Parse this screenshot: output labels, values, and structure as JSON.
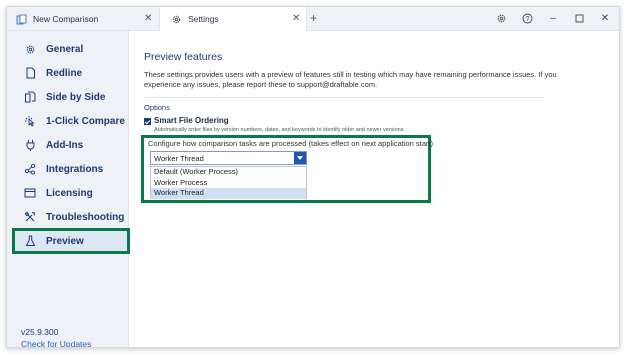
{
  "tabs": {
    "inactive": {
      "label": "New Comparison",
      "icon": "document-compare-icon"
    },
    "active": {
      "label": "Settings",
      "icon": "gear-icon"
    }
  },
  "window_controls": [
    "gear-icon",
    "help-icon",
    "minimize-icon",
    "maximize-icon",
    "close-icon"
  ],
  "sidebar": {
    "items": [
      {
        "label": "General",
        "icon": "gear-icon"
      },
      {
        "label": "Redline",
        "icon": "document-icon"
      },
      {
        "label": "Side by Side",
        "icon": "side-by-side-icon"
      },
      {
        "label": "1-Click Compare",
        "icon": "click-icon"
      },
      {
        "label": "Add-Ins",
        "icon": "plug-icon"
      },
      {
        "label": "Integrations",
        "icon": "share-icon"
      },
      {
        "label": "Licensing",
        "icon": "card-icon"
      },
      {
        "label": "Troubleshooting",
        "icon": "tools-icon"
      },
      {
        "label": "Preview",
        "icon": "flask-icon",
        "active": true
      }
    ],
    "version": "v25.9.300",
    "check_updates": "Check for Updates"
  },
  "main": {
    "title": "Preview features",
    "description": "These settings provides users with a preview of features still in testing which may have remaining performance issues. If you experience any issues, please report these to support@draftable.com.",
    "options_heading": "Options",
    "smart_ordering": {
      "label": "Smart File Ordering",
      "checked": true,
      "subtext": "Automatically order files by version numbers, dates, and keywords to identify older and newer versions"
    },
    "processing": {
      "label": "Configure how comparison tasks are processed (takes effect on next application start)",
      "selected": "Worker Thread",
      "options": [
        "Default (Worker Process)",
        "Worker Process",
        "Worker Thread"
      ]
    }
  },
  "colors": {
    "accent_green": "#0b7a4a",
    "brand_blue": "#1f56b8",
    "nav_text": "#1f3b73"
  }
}
